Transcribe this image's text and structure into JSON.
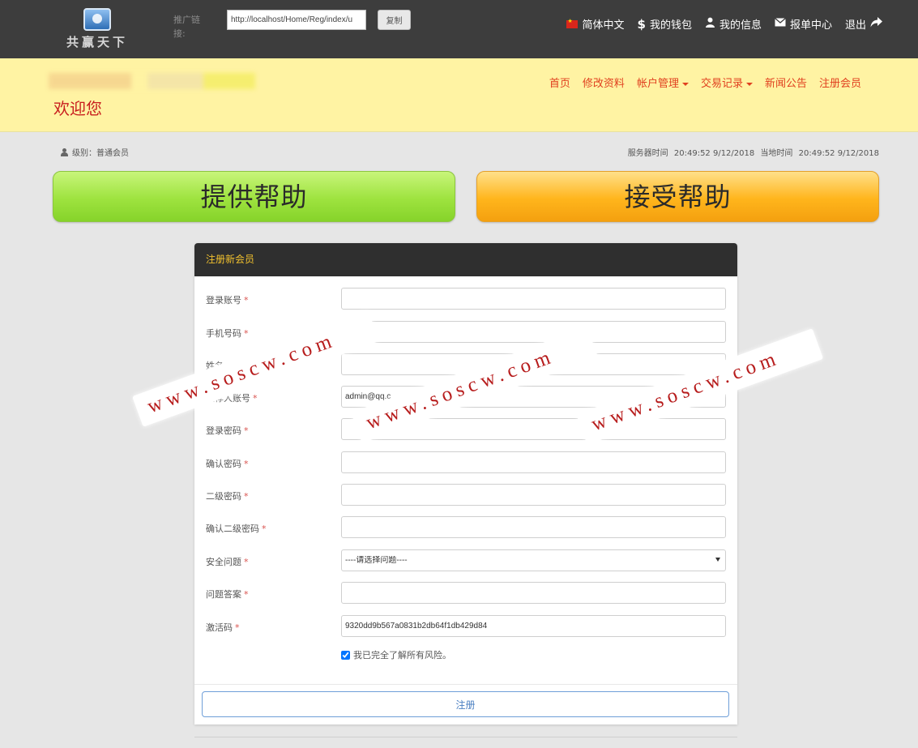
{
  "topbar": {
    "logo_text": "共赢天下",
    "promo_label": "推广链接:",
    "promo_link": "http://localhost/Home/Reg/index/u",
    "copy_label": "复制",
    "nav": {
      "language": "简体中文",
      "wallet_icon": "$",
      "wallet": "我的钱包",
      "info": "我的信息",
      "reports": "报单中心",
      "logout": "退出"
    }
  },
  "header": {
    "welcome": "欢迎您",
    "nav": [
      "首页",
      "修改资料",
      "帐户管理",
      "交易记录",
      "新闻公告",
      "注册会员"
    ],
    "accent_color": "#e0401f",
    "background_color": "#fff3a3"
  },
  "info": {
    "level": "级别：普通会员",
    "server_time_label": "服务器时间",
    "server_time": "20:49:52 9/12/2018",
    "local_time_label": "当地时间",
    "local_time": "20:49:52 9/12/2018"
  },
  "help": {
    "provide": "提供帮助",
    "receive": "接受帮助"
  },
  "form": {
    "title": "注册新会员",
    "fields": {
      "account": {
        "label": "登录账号",
        "value": ""
      },
      "phone": {
        "label": "手机号码",
        "value": ""
      },
      "name": {
        "label": "姓名",
        "value": ""
      },
      "referrer": {
        "label": "推荐人账号",
        "value": "admin@qq.c"
      },
      "password": {
        "label": "登录密码",
        "value": ""
      },
      "password_confirm": {
        "label": "确认密码",
        "value": ""
      },
      "password2": {
        "label": "二级密码",
        "value": ""
      },
      "password2_confirm": {
        "label": "确认二级密码",
        "value": ""
      },
      "security_question": {
        "label": "安全问题",
        "value": "----请选择问题----"
      },
      "answer": {
        "label": "问题答案",
        "value": ""
      },
      "activation_code": {
        "label": "激活码",
        "value": "9320dd9b567a0831b2db64f1db429d84"
      }
    },
    "required_mark": "*",
    "agree_text": "我已完全了解所有风险。",
    "submit": "注册"
  },
  "watermark": "www.soscw.com"
}
